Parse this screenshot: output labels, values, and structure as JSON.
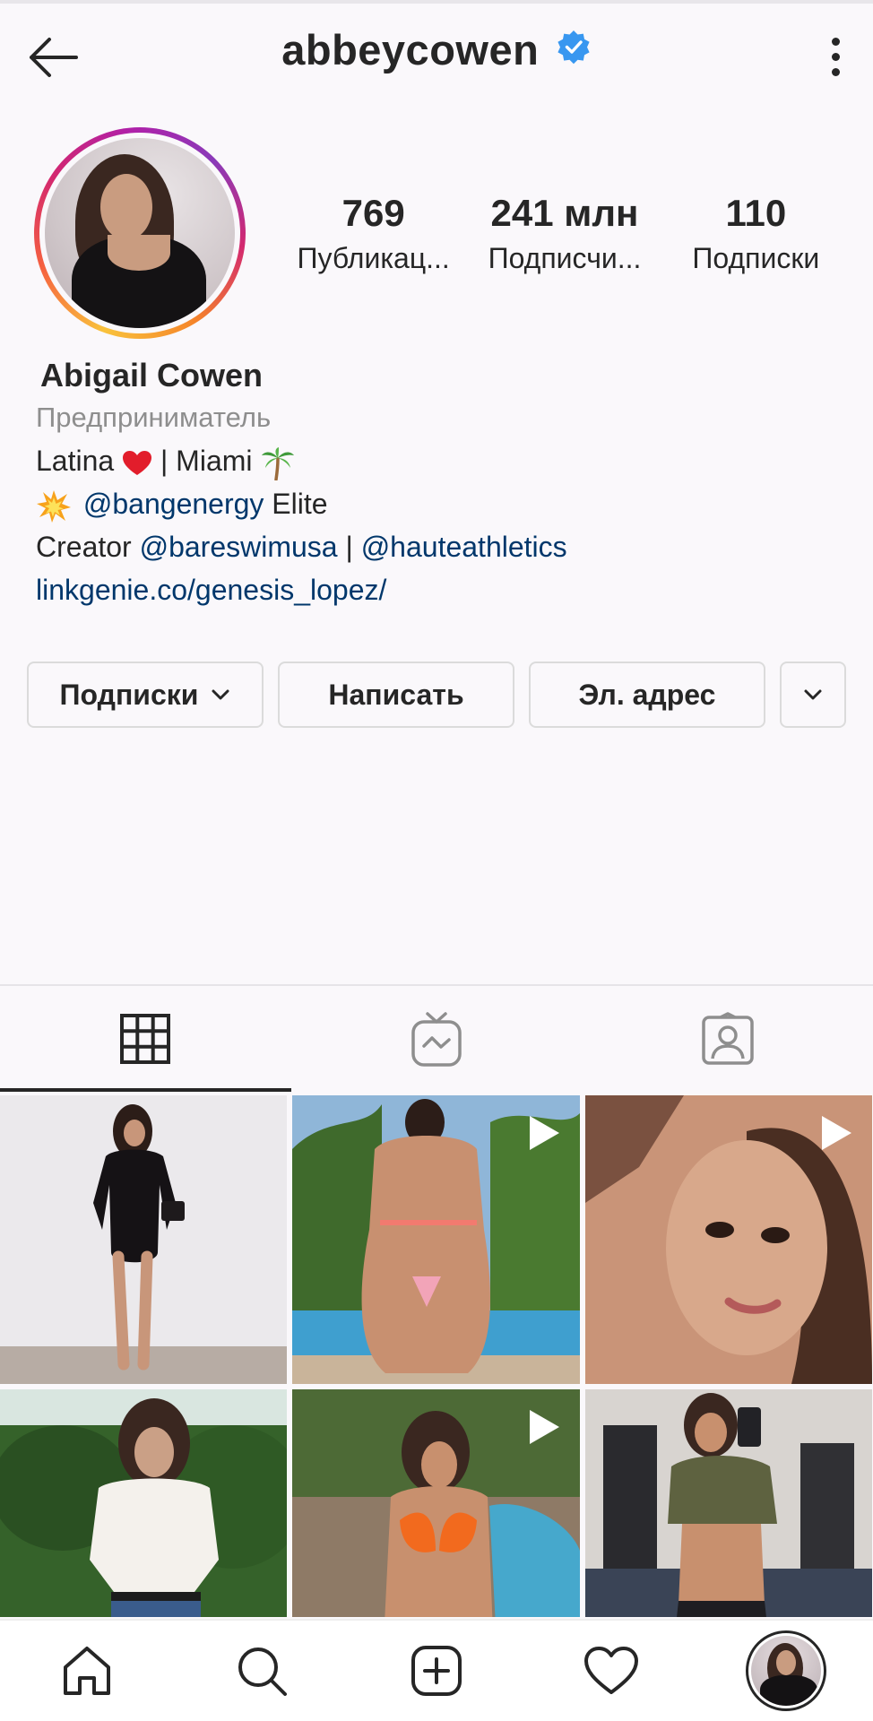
{
  "header": {
    "username": "abbeycowen",
    "verified": true,
    "back_icon": "arrow-left-icon",
    "menu_icon": "more-vertical-icon"
  },
  "profile": {
    "stats": [
      {
        "value": "769",
        "label": "Публикац..."
      },
      {
        "value": "241 млн",
        "label": "Подписчи..."
      },
      {
        "value": "110",
        "label": "Подписки"
      }
    ],
    "name": "Abigail Cowen",
    "category": "Предприниматель",
    "bio": {
      "line1_a": "Latina",
      "line1_b": "| Miami",
      "line2_mention": "@bangenergy",
      "line2_rest": "Elite",
      "line3_prefix": "Creator",
      "line3_mention1": "@bareswimusa",
      "line3_sep": "|",
      "line3_mention2": "@hauteathletics",
      "link": "linkgenie.co/genesis_lopez/"
    }
  },
  "actions": {
    "following": "Подписки",
    "message": "Написать",
    "email": "Эл. адрес"
  },
  "tabs": [
    "grid-icon",
    "igtv-icon",
    "tagged-icon"
  ],
  "posts": [
    {
      "type": "photo"
    },
    {
      "type": "video"
    },
    {
      "type": "video"
    },
    {
      "type": "photo"
    },
    {
      "type": "video"
    },
    {
      "type": "photo"
    }
  ],
  "bottom_nav": [
    "home-icon",
    "search-icon",
    "add-post-icon",
    "activity-heart-icon",
    "profile-avatar"
  ],
  "colors": {
    "link": "#00376b",
    "verified": "#3897f0",
    "muted": "#8e8e8e"
  }
}
